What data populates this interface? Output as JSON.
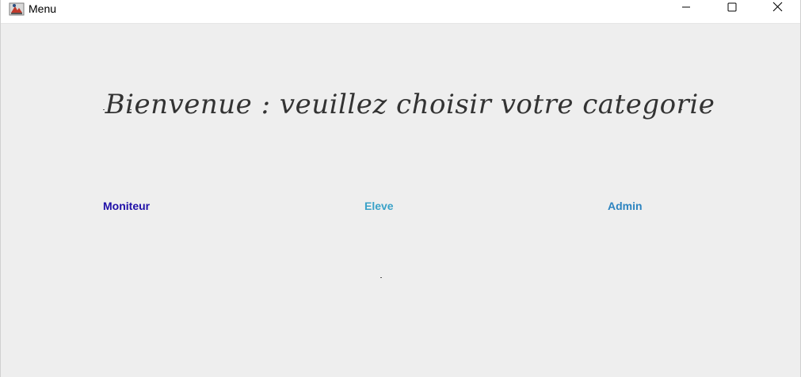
{
  "window": {
    "title": "Menu"
  },
  "main": {
    "heading": "Bienvenue : veuillez choisir votre categorie"
  },
  "categories": [
    {
      "label": "Moniteur",
      "color": "#1f0fa8"
    },
    {
      "label": "Eleve",
      "color": "#3aa2c8"
    },
    {
      "label": "Admin",
      "color": "#2d84c0"
    }
  ],
  "icons": {
    "app": "java-app-icon",
    "minimize": "minimize-icon",
    "maximize": "maximize-icon",
    "close": "close-icon"
  }
}
